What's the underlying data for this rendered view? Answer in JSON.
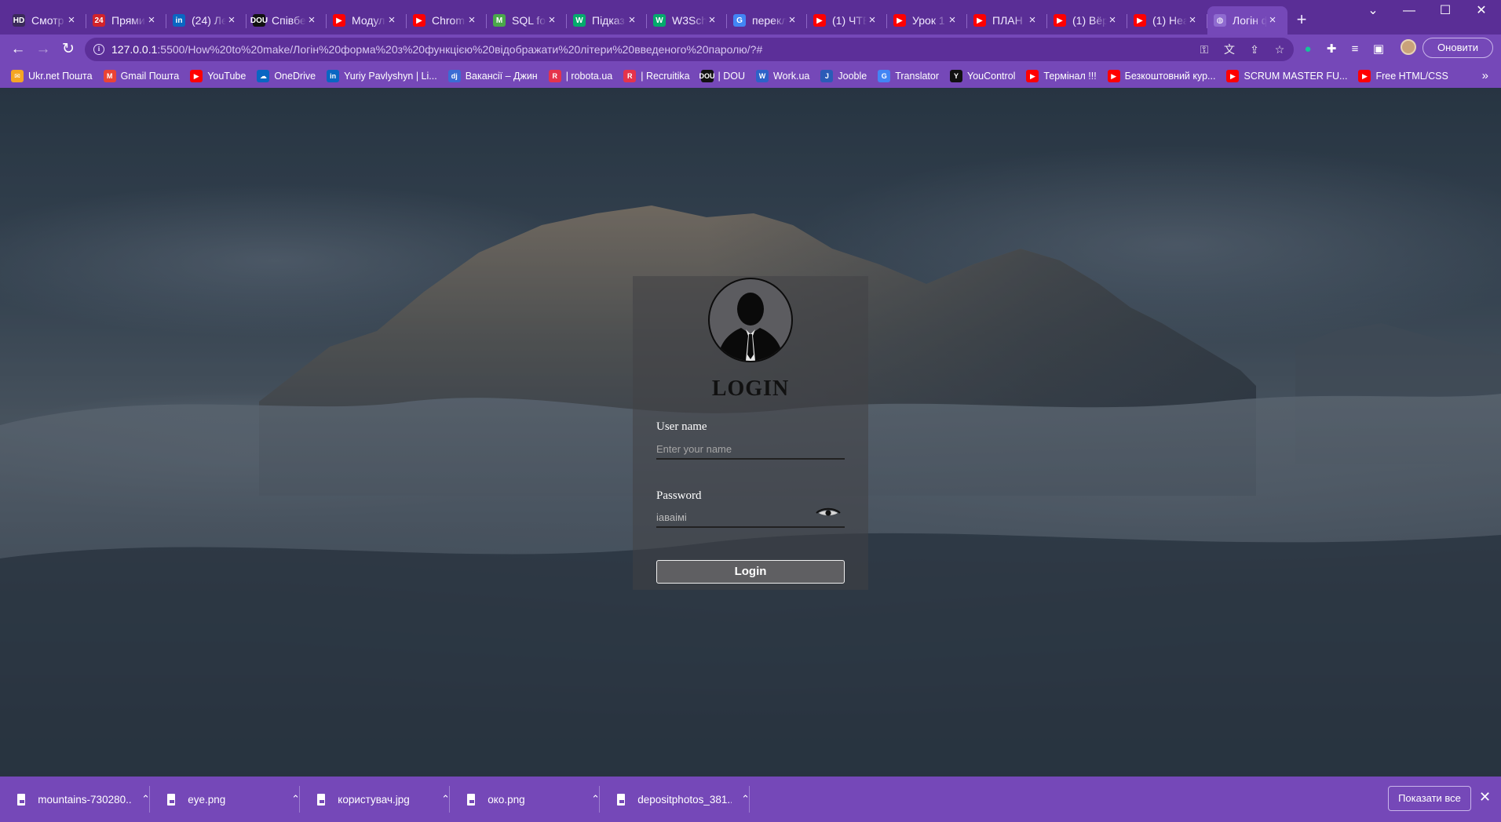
{
  "tabs": [
    {
      "title": "Смотр",
      "favicon": "hd-icon",
      "color": "#3a2a5a",
      "glyph": "HD"
    },
    {
      "title": "Прями",
      "favicon": "channel24-icon",
      "color": "#d2232a",
      "glyph": "24"
    },
    {
      "title": "(24) Ле",
      "favicon": "linkedin-icon",
      "color": "#0a66c2",
      "glyph": "in"
    },
    {
      "title": "Співбе",
      "favicon": "dou-icon",
      "color": "#111111",
      "glyph": "DOU"
    },
    {
      "title": "Модул",
      "favicon": "youtube-icon",
      "color": "#ff0000",
      "glyph": "▶"
    },
    {
      "title": "Chrom",
      "favicon": "youtube-icon",
      "color": "#ff0000",
      "glyph": "▶"
    },
    {
      "title": "SQL fo",
      "favicon": "m-logo-icon",
      "color": "#4aa84a",
      "glyph": "M"
    },
    {
      "title": "Підказ",
      "favicon": "w3-icon",
      "color": "#04aa6d",
      "glyph": "W"
    },
    {
      "title": "W3Sch",
      "favicon": "w3schools-icon",
      "color": "#04aa6d",
      "glyph": "W"
    },
    {
      "title": "перекл",
      "favicon": "google-icon",
      "color": "#4285f4",
      "glyph": "G"
    },
    {
      "title": "(1) ЧТЕ",
      "favicon": "youtube-icon",
      "color": "#ff0000",
      "glyph": "▶"
    },
    {
      "title": "Урок 1",
      "favicon": "youtube-icon",
      "color": "#ff0000",
      "glyph": "▶"
    },
    {
      "title": "ПЛАН",
      "favicon": "youtube-icon",
      "color": "#ff0000",
      "glyph": "▶"
    },
    {
      "title": "(1) Вёр",
      "favicon": "youtube-icon",
      "color": "#ff0000",
      "glyph": "▶"
    },
    {
      "title": "(1) Неа",
      "favicon": "youtube-icon",
      "color": "#ff0000",
      "glyph": "▶"
    },
    {
      "title": "Логін ф",
      "favicon": "globe-icon",
      "color": "#8f6bd0",
      "glyph": "◍",
      "active": true
    }
  ],
  "window": {
    "minimize": "—",
    "maximize": "☐",
    "close": "✕",
    "tab_search": "⌄",
    "new_tab": "+"
  },
  "toolbar": {
    "url_host": "127.0.0.1",
    "url_rest": ":5500/How%20to%20make/Логін%20форма%20з%20функцією%20відображати%20літери%20введеного%20паролю/?#",
    "update_label": "Оновити"
  },
  "bookmarks": [
    {
      "label": "Ukr.net Пошта",
      "icon": "ukrnet-icon",
      "color": "#f5a623",
      "glyph": "✉"
    },
    {
      "label": "Gmail Пошта",
      "icon": "gmail-icon",
      "color": "#ea4335",
      "glyph": "M"
    },
    {
      "label": "YouTube",
      "icon": "youtube-icon",
      "color": "#ff0000",
      "glyph": "▶"
    },
    {
      "label": "OneDrive",
      "icon": "onedrive-icon",
      "color": "#0a66c2",
      "glyph": "☁"
    },
    {
      "label": "Yuriy Pavlyshyn | Li...",
      "icon": "linkedin-icon",
      "color": "#0a66c2",
      "glyph": "in"
    },
    {
      "label": "Вакансії – Джин",
      "icon": "djinni-icon",
      "color": "#3b6cd4",
      "glyph": "dj"
    },
    {
      "label": "| robota.ua",
      "icon": "robota-icon",
      "color": "#e5334b",
      "glyph": "R"
    },
    {
      "label": "| Recruitika",
      "icon": "recruitika-icon",
      "color": "#e5334b",
      "glyph": "R"
    },
    {
      "label": "| DOU",
      "icon": "dou-icon",
      "color": "#111111",
      "glyph": "DOU"
    },
    {
      "label": "Work.ua",
      "icon": "workua-icon",
      "color": "#2d62c8",
      "glyph": "W"
    },
    {
      "label": "Jooble",
      "icon": "jooble-icon",
      "color": "#2b5bb7",
      "glyph": "J"
    },
    {
      "label": "Translator",
      "icon": "google-icon",
      "color": "#4285f4",
      "glyph": "G"
    },
    {
      "label": "YouControl",
      "icon": "youcontrol-icon",
      "color": "#111111",
      "glyph": "Y"
    },
    {
      "label": "Термінал !!!",
      "icon": "youtube-icon",
      "color": "#ff0000",
      "glyph": "▶"
    },
    {
      "label": "Безкоштовний кур...",
      "icon": "youtube-icon",
      "color": "#ff0000",
      "glyph": "▶"
    },
    {
      "label": "SCRUM MASTER FU...",
      "icon": "youtube-icon",
      "color": "#ff0000",
      "glyph": "▶"
    },
    {
      "label": "Free HTML/CSS",
      "icon": "youtube-icon",
      "color": "#ff0000",
      "glyph": "▶"
    }
  ],
  "bookmarks_more": "»",
  "login": {
    "title": "LOGIN",
    "username_label": "User name",
    "username_placeholder": "Enter your name",
    "password_label": "Password",
    "password_value": "іаваімі",
    "button_label": "Login"
  },
  "downloads": [
    {
      "name": "mountains-730280....jpg"
    },
    {
      "name": "eye.png"
    },
    {
      "name": "користувач.jpg"
    },
    {
      "name": "око.png"
    },
    {
      "name": "depositphotos_381....jpg"
    }
  ],
  "downloads_chevron": "⌃",
  "show_all_label": "Показати все",
  "colors": {
    "chrome_purple": "#7548b8",
    "tabstrip_purple": "#5a2e96",
    "omnibox": "#5c2f99"
  }
}
